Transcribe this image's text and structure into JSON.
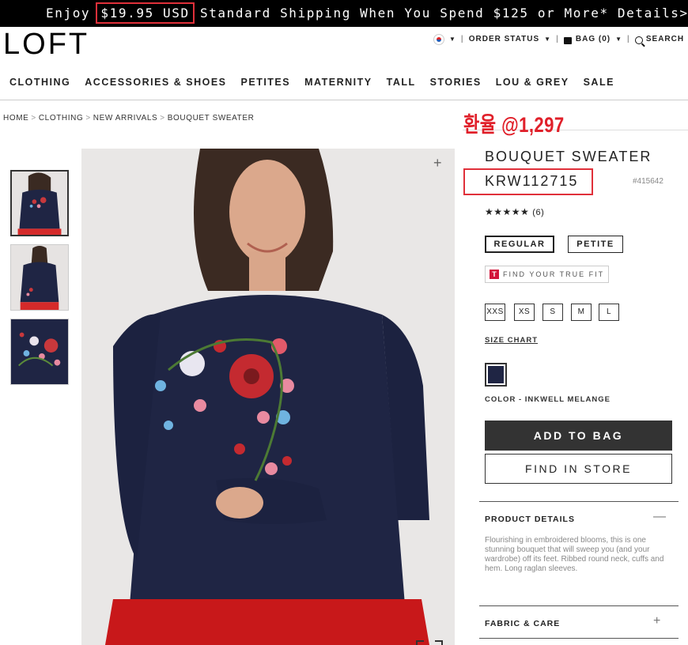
{
  "promo": {
    "prefix": "Enjoy",
    "price": "$19.95 USD",
    "suffix": "Standard Shipping When You Spend $125 or More* Details>"
  },
  "header": {
    "logo": "LOFT",
    "order_status": "ORDER STATUS",
    "bag": "BAG (0)",
    "search": "SEARCH"
  },
  "nav": {
    "items": [
      "CLOTHING",
      "ACCESSORIES & SHOES",
      "PETITES",
      "MATERNITY",
      "TALL",
      "STORIES",
      "LOU & GREY",
      "SALE"
    ]
  },
  "breadcrumb": {
    "items": [
      "HOME",
      "CLOTHING",
      "NEW ARRIVALS",
      "BOUQUET SWEATER"
    ]
  },
  "annotation": {
    "exchange_rate": "환율 @1,297"
  },
  "product": {
    "title": "BOUQUET SWEATER",
    "price": "KRW112715",
    "sku": "#415642",
    "stars": "★★★★★",
    "review_count": "(6)",
    "fits": [
      "REGULAR",
      "PETITE"
    ],
    "true_fit_badge": "T",
    "true_fit": "FIND YOUR TRUE FIT",
    "sizes": [
      "XXS",
      "XS",
      "S",
      "M",
      "L"
    ],
    "size_chart": "SIZE CHART",
    "color_label": "COLOR - INKWELL MELANGE",
    "swatch_color": "#1f2544",
    "add_to_bag": "ADD TO BAG",
    "find_in_store": "FIND IN STORE",
    "details_heading": "PRODUCT DETAILS",
    "details_toggle": "—",
    "details_text": "Flourishing in embroidered blooms, this is one stunning bouquet that will sweep you (and your wardrobe) off its feet. Ribbed round neck, cuffs and hem. Long raglan sleeves.",
    "fabric_heading": "FABRIC & CARE",
    "fabric_toggle": "+"
  },
  "gallery": {
    "zoom": "+"
  },
  "colors": {
    "highlight": "#e0303a",
    "primary_button": "#333333",
    "true_fit_red": "#d2143a"
  }
}
